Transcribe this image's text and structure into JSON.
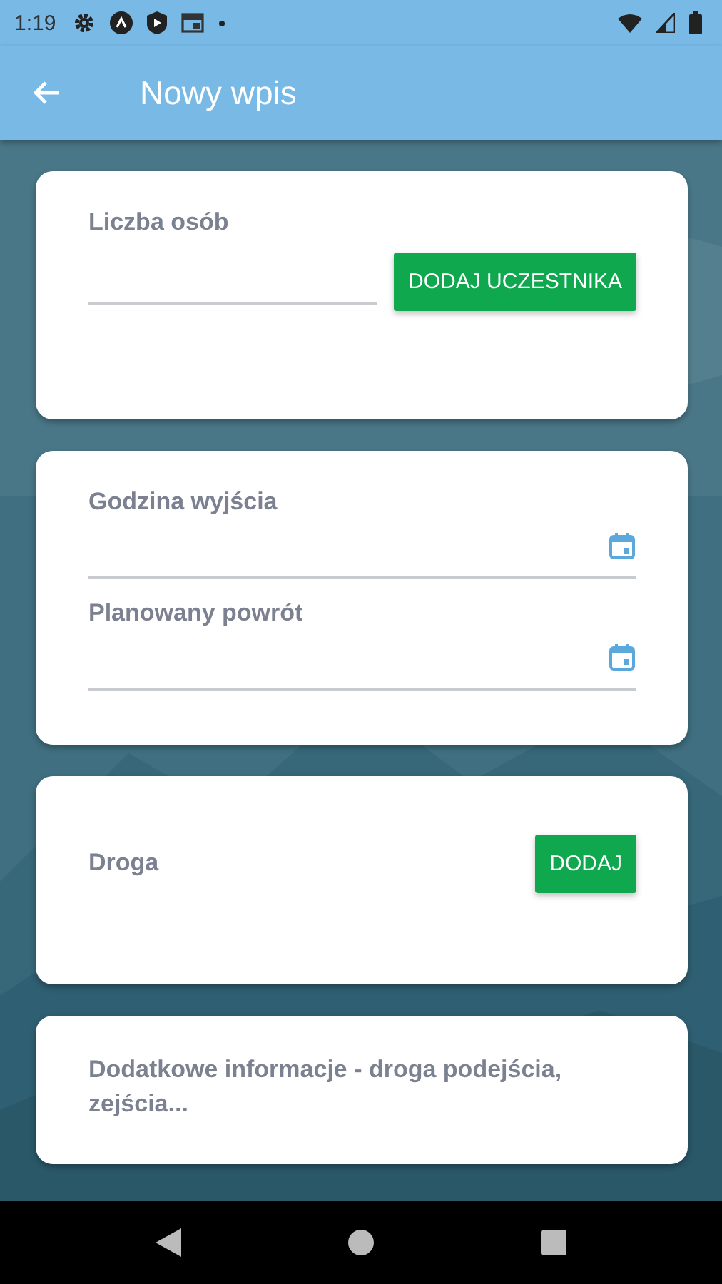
{
  "status_bar": {
    "time": "1:19"
  },
  "app_bar": {
    "title": "Nowy wpis"
  },
  "cards": [
    {
      "kind": "field_with_button",
      "label": "Liczba osób",
      "button": "DODAJ UCZESTNIKA"
    },
    {
      "kind": "date_fields",
      "fields": [
        {
          "label": "Godzina wyjścia"
        },
        {
          "label": "Planowany powrót"
        }
      ]
    },
    {
      "kind": "label_with_button",
      "label": "Droga",
      "button": "DODAJ"
    },
    {
      "kind": "text_area",
      "label": "Dodatkowe informacje - droga podejścia, zejścia..."
    }
  ]
}
